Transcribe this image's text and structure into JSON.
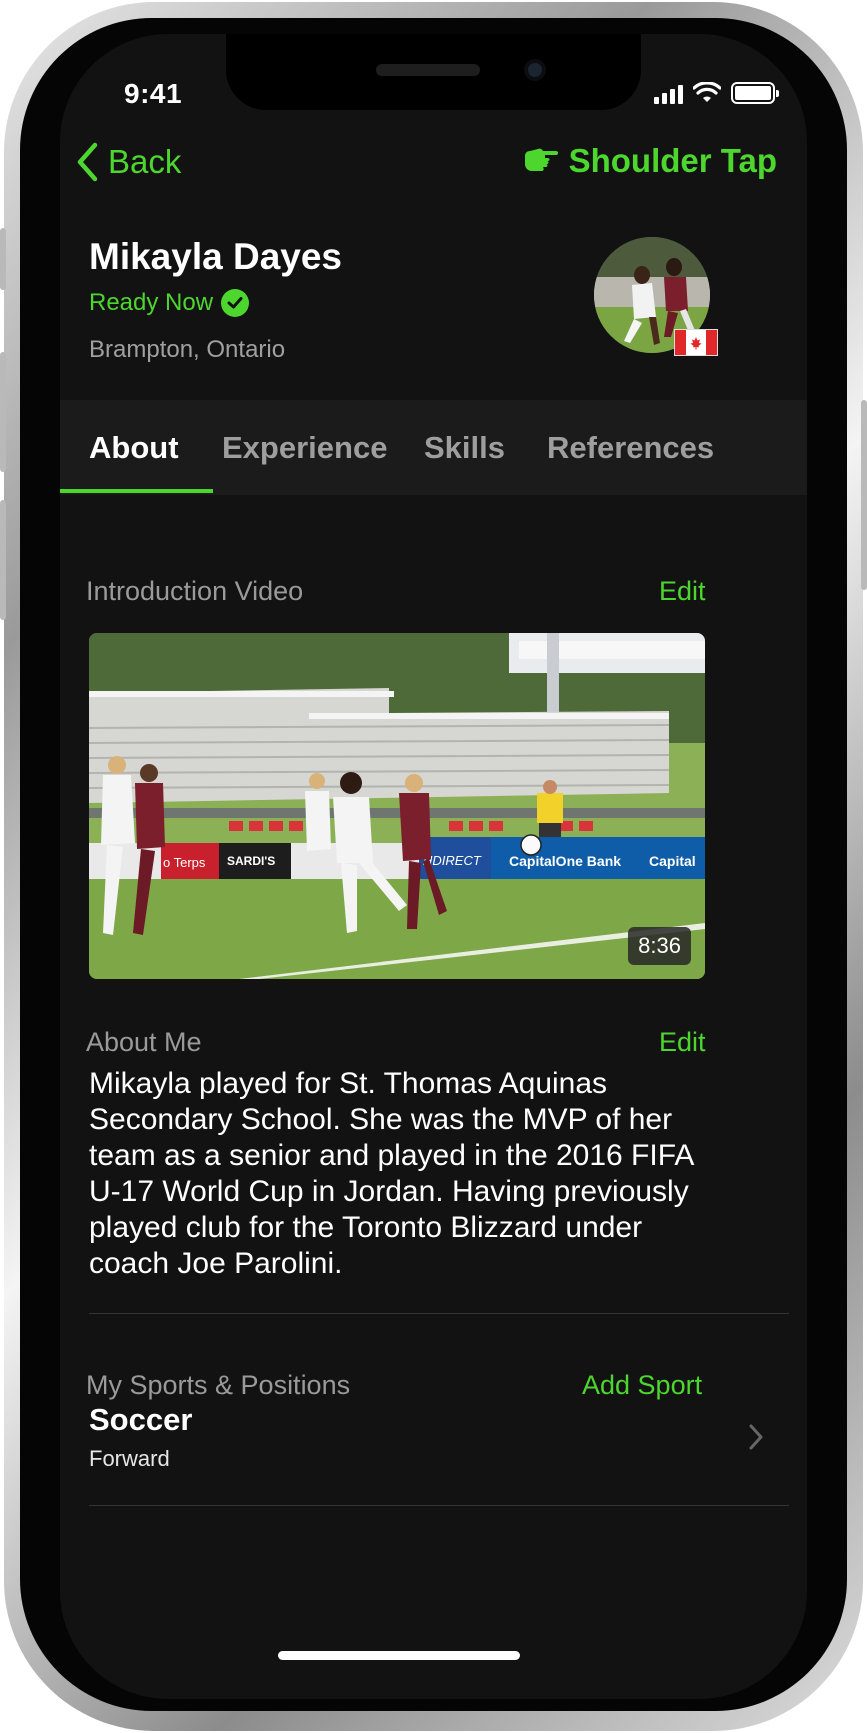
{
  "status_bar": {
    "time": "9:41"
  },
  "nav": {
    "back_label": "Back",
    "action_label": "Shoulder Tap"
  },
  "profile": {
    "name": "Mikayla Dayes",
    "availability": "Ready Now",
    "location": "Brampton, Ontario"
  },
  "tabs": [
    {
      "label": "About",
      "active": true
    },
    {
      "label": "Experience",
      "active": false
    },
    {
      "label": "Skills",
      "active": false
    },
    {
      "label": "References",
      "active": false
    }
  ],
  "intro_video": {
    "title": "Introduction Video",
    "edit_label": "Edit",
    "duration": "8:36",
    "banner_texts": [
      "o Terps",
      "SARDI'S",
      "HDIRECT",
      "CapitalOne Bank",
      "Capital"
    ]
  },
  "about_me": {
    "title": "About Me",
    "edit_label": "Edit",
    "text": "Mikayla played for St. Thomas Aquinas Secondary School. She was the MVP of her team as a senior and played in the 2016 FIFA U-17 World Cup in Jordan. Having previously played club for the Toronto Blizzard under coach Joe Parolini."
  },
  "sports": {
    "title": "My Sports & Positions",
    "add_label": "Add Sport",
    "items": [
      {
        "sport": "Soccer",
        "position": "Forward"
      }
    ]
  },
  "colors": {
    "accent": "#4cd62e",
    "background": "#121212",
    "tab_bar": "#1b1b1b"
  }
}
